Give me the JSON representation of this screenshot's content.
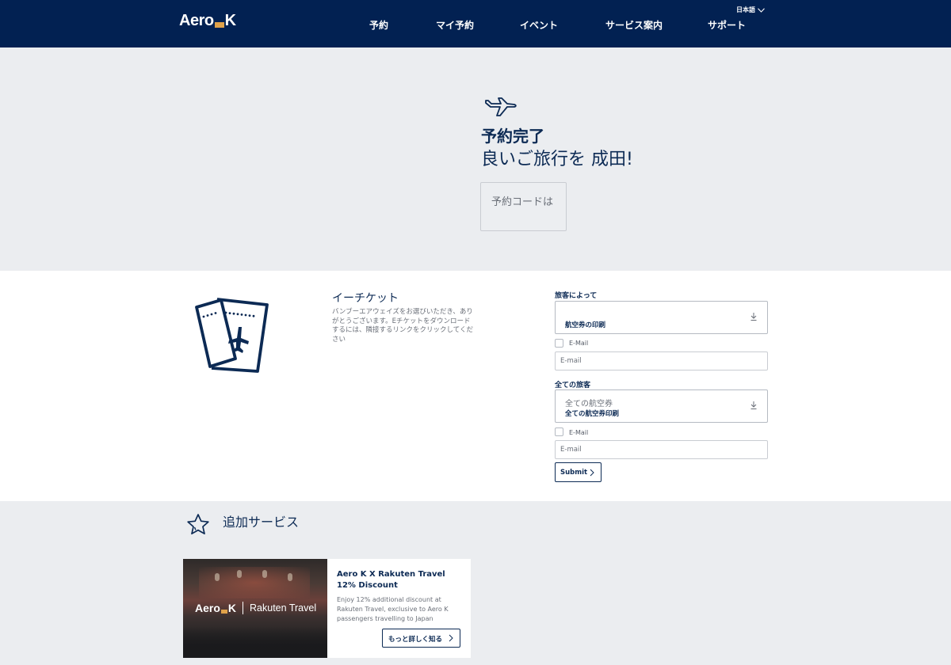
{
  "header": {
    "logo": {
      "left": "Aero",
      "right": "K"
    },
    "nav": [
      "予約",
      "マイ予約",
      "イベント",
      "サービス案内",
      "サポート"
    ],
    "language": "日本語"
  },
  "confirmation": {
    "title": "予約完了",
    "subtitle": "良いご旅行を 成田!",
    "code_label": "予約コードは"
  },
  "eticket": {
    "title": "イーチケット",
    "description": "バンブーエアウェイズをお選びいただき、ありがとうございます。Eチケットをダウンロードするには、隣接するリンクをクリックしてください",
    "by_passenger": {
      "label": "旅客によって",
      "select_value": "",
      "select_caption": "航空券の印刷",
      "checkbox_label": "E-Mail",
      "email_placeholder": "E-mail"
    },
    "all_passengers": {
      "label": "全ての旅客",
      "select_value": "全ての航空券",
      "select_caption": "全ての航空券印刷",
      "checkbox_label": "E-Mail",
      "email_placeholder": "E-mail"
    },
    "submit_label": "Submit"
  },
  "additional": {
    "title": "追加サービス",
    "card": {
      "image_brand_left": "Aero",
      "image_brand_right": "K",
      "image_partner": "Rakuten Travel",
      "title": "Aero K X Rakuten Travel 12% Discount",
      "description": "Enjoy 12% additional discount at Rakuten Travel, exclusive to Aero K passengers travelling to Japan",
      "button_label": "もっと詳しく知る"
    }
  },
  "colors": {
    "navy": "#022152",
    "accent": "#e0a24a",
    "text": "#0c2a54",
    "background": "#ebedf0"
  }
}
